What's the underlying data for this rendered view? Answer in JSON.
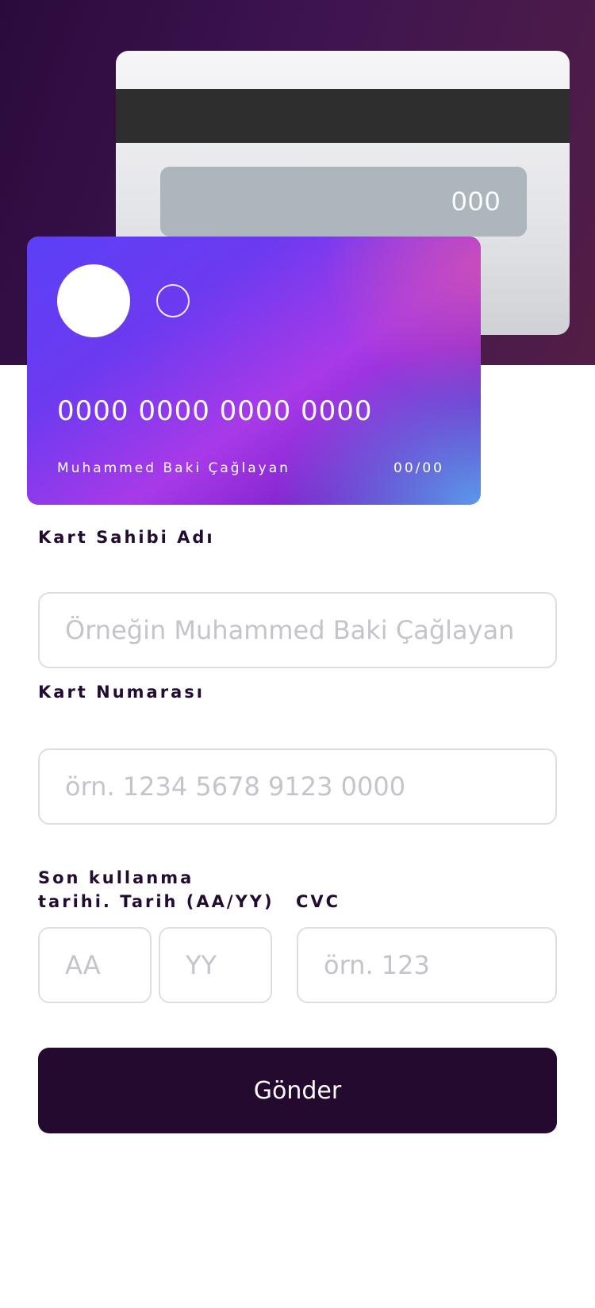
{
  "card_back": {
    "cvc": "000"
  },
  "card_front": {
    "number": "0000 0000 0000 0000",
    "holder": "Muhammed Baki Çağlayan",
    "expiry": "00/00"
  },
  "form": {
    "name_label": "Kart Sahibi Adı",
    "name_placeholder": "Örneğin Muhammed Baki Çağlayan",
    "number_label": "Kart Numarası",
    "number_placeholder": "örn. 1234 5678 9123 0000",
    "expiry_label_line1": "Son kullanma",
    "expiry_label_line2": "tarihi. Tarih (AA/YY)",
    "month_placeholder": "AA",
    "year_placeholder": "YY",
    "cvc_label": "CVC",
    "cvc_placeholder": "örn. 123",
    "submit_label": "Gönder"
  },
  "colors": {
    "hero_background": "#3e1450",
    "button_background": "#240a2f",
    "label_text": "#220c30",
    "input_border": "#dedde2",
    "placeholder_text": "#c5c3cb"
  }
}
